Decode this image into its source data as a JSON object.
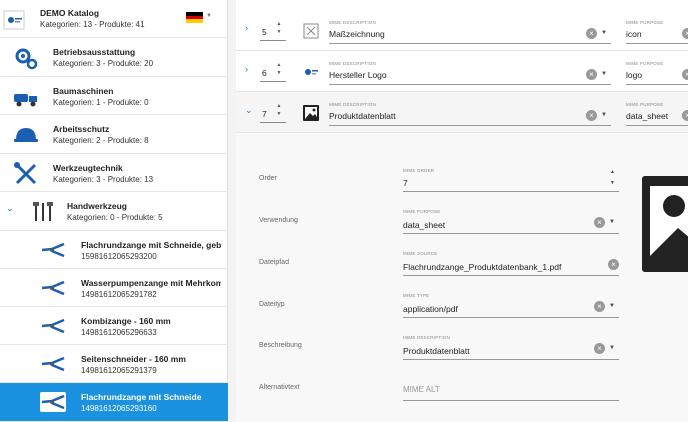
{
  "catalog": {
    "title": "DEMO Katalog",
    "subtitle": "Kategorien: 13 - Produkte: 41",
    "language_flag": "de-flag-icon",
    "flag_colors": [
      "#000000",
      "#dd0000",
      "#ffce00"
    ]
  },
  "categories": [
    {
      "name": "Betriebsausstattung",
      "sub": "Kategorien: 3 - Produkte: 20",
      "icon": "gears-icon"
    },
    {
      "name": "Baumaschinen",
      "sub": "Kategorien: 1 - Produkte: 0",
      "icon": "cement-truck-icon"
    },
    {
      "name": "Arbeitsschutz",
      "sub": "Kategorien: 2 - Produkte: 8",
      "icon": "hard-hat-icon"
    },
    {
      "name": "Werkzeugtechnik",
      "sub": "Kategorien: 3 - Produkte: 13",
      "icon": "wrench-screwdriver-icon"
    },
    {
      "name": "Handwerkzeug",
      "sub": "Kategorien: 0 - Produkte: 5",
      "icon": "hand-tools-icon"
    }
  ],
  "products": [
    {
      "name": "Flachrundzange mit Schneide, gebogen",
      "id": "15981612065293200"
    },
    {
      "name": "Wasserpumpenzange mit Mehrkomponenten",
      "id": "14981612065291782"
    },
    {
      "name": "Kombizange - 160 mm",
      "id": "14981612065296633"
    },
    {
      "name": "Seitenschneider - 160 mm",
      "id": "14981612065291379"
    },
    {
      "name": "Flachrundzange mit Schneide",
      "id": "14981612065293160"
    }
  ],
  "media_rows": [
    {
      "order": "5",
      "desc_label": "MIME DESCRIPTION",
      "desc": "Maßzeichnung",
      "purpose_label": "MIME PURPOSE",
      "purpose": "icon",
      "icon": "drawing-icon"
    },
    {
      "order": "6",
      "desc_label": "MIME DESCRIPTION",
      "desc": "Hersteller Logo",
      "purpose_label": "MIME PURPOSE",
      "purpose": "logo",
      "icon": "logo-icon"
    },
    {
      "order": "7",
      "desc_label": "MIME DESCRIPTION",
      "desc": "Produktdatenblatt",
      "purpose_label": "MIME PURPOSE",
      "purpose": "data_sheet",
      "icon": "image-icon"
    }
  ],
  "detail": {
    "order_label": "Order",
    "order_field_label": "MIME ORDER",
    "order_value": "7",
    "usage_label": "Verwendung",
    "usage_field_label": "MIME PURPOSE",
    "usage_value": "data_sheet",
    "file_label": "Dateipfad",
    "file_field_label": "MIME SOURCE",
    "file_value": "Flachrundzange_Produktdatenbank_1.pdf",
    "type_label": "Dateityp",
    "type_field_label": "MIME TYPE",
    "type_value": "application/pdf",
    "desc_label": "Beschreibung",
    "desc_field_label": "MIME DESCRIPTION",
    "desc_value": "Produktdatenblatt",
    "alt_label": "Alternativtext",
    "alt_placeholder": "MIME ALT"
  },
  "colors": {
    "accent": "#1b92e0",
    "icon_blue": "#1a5fb4"
  }
}
